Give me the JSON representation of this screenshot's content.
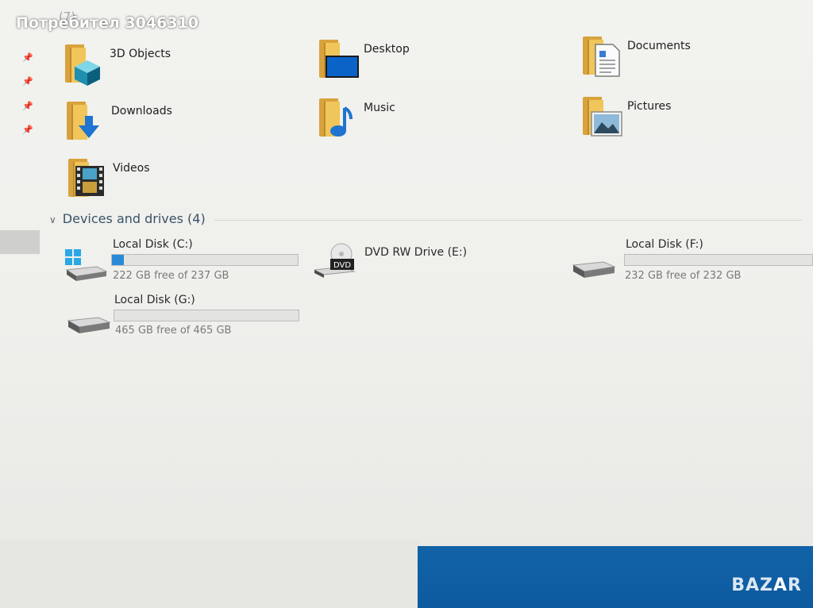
{
  "watermark": {
    "user_label": "Потребител 3046310"
  },
  "folders_section": {
    "hidden_header": "(7)"
  },
  "pins": [
    "pin",
    "pin",
    "pin",
    "pin"
  ],
  "folders": [
    {
      "label": "3D Objects",
      "icon": "3d-objects-icon"
    },
    {
      "label": "Desktop",
      "icon": "desktop-icon"
    },
    {
      "label": "Documents",
      "icon": "documents-icon"
    },
    {
      "label": "Downloads",
      "icon": "downloads-icon"
    },
    {
      "label": "Music",
      "icon": "music-icon"
    },
    {
      "label": "Pictures",
      "icon": "pictures-icon"
    },
    {
      "label": "Videos",
      "icon": "videos-icon"
    }
  ],
  "devices": {
    "title": "Devices and drives (4)",
    "drives": [
      {
        "name": "Local Disk (C:)",
        "free": "222 GB free of 237 GB",
        "used_fraction": 0.063,
        "icon": "windows-drive-icon"
      },
      {
        "name": "DVD RW Drive (E:)",
        "free": "",
        "icon": "dvd-drive-icon",
        "badge": "DVD"
      },
      {
        "name": "Local Disk (F:)",
        "free": "232 GB free of 232 GB",
        "used_fraction": 0.0,
        "icon": "hard-drive-icon"
      },
      {
        "name": "Local Disk (G:)",
        "free": "465 GB free of 465 GB",
        "used_fraction": 0.0,
        "icon": "hard-drive-icon"
      }
    ]
  },
  "branding": {
    "logo_text": "BAZAR"
  },
  "colors": {
    "accent": "#2a8ad8",
    "taskbar": "#1163a8",
    "folder": "#f0c65a"
  }
}
